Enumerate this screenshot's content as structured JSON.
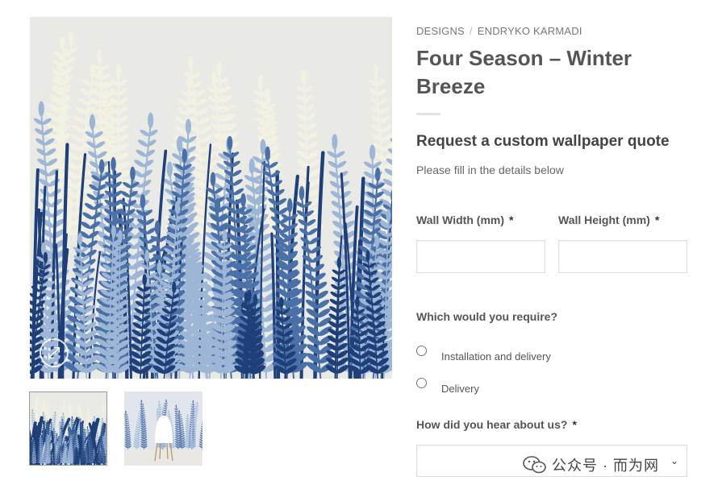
{
  "breadcrumb": {
    "items": [
      "DESIGNS",
      "ENDRYKO KARMADI"
    ],
    "separator": "/"
  },
  "product": {
    "title": "Four Season – Winter Breeze"
  },
  "form": {
    "heading": "Request a custom wallpaper quote",
    "subheading": "Please fill in the details below",
    "wall_width_label": "Wall Width (mm)",
    "wall_height_label": "Wall Height (mm)",
    "required_mark": "*",
    "wall_width_value": "",
    "wall_height_value": "",
    "require_question": "Which would you require?",
    "options": [
      "Installation and delivery",
      "Delivery"
    ],
    "hear_question": "How did you hear about us?",
    "hear_selected": ""
  },
  "gallery": {
    "icons": {
      "zoom": "expand-arrows-icon",
      "select_chevron": "chevron-down-icon"
    }
  },
  "watermark": {
    "text": "公众号 · 而为网",
    "icon": "wechat-icon"
  },
  "colors": {
    "leaf_dark": "#1f3f78",
    "leaf_mid": "#4a70a8",
    "leaf_light": "#9db6d6",
    "leaf_pale": "#f3f1e2",
    "background_sky": "#e9e9e6"
  }
}
